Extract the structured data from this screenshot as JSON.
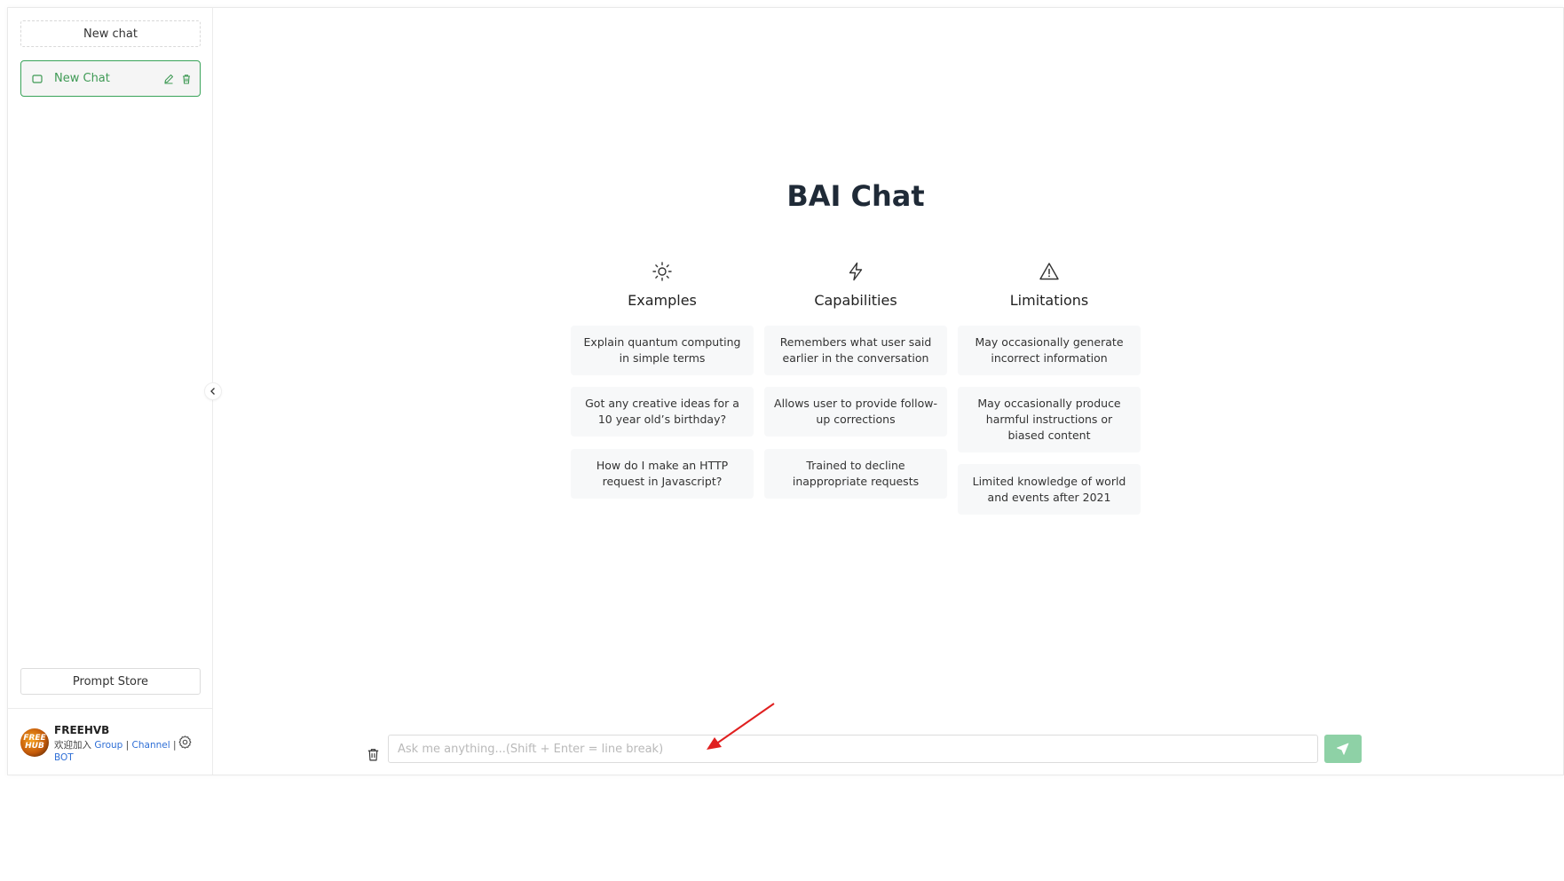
{
  "sidebar": {
    "new_chat_button": "New chat",
    "chat_items": [
      {
        "label": "New Chat"
      }
    ],
    "prompt_store_button": "Prompt Store",
    "user": {
      "name": "FREEHVB",
      "avatar_text": "FREE HUB",
      "welcome": "欢迎加入",
      "links": [
        "Group",
        "Channel",
        "BOT"
      ],
      "separator": "|"
    }
  },
  "main": {
    "title": "BAI Chat",
    "columns": [
      {
        "icon": "sun-icon",
        "title": "Examples",
        "cards": [
          "Explain quantum computing in simple terms",
          "Got any creative ideas for a 10 year old’s birthday?",
          "How do I make an HTTP request in Javascript?"
        ]
      },
      {
        "icon": "lightning-icon",
        "title": "Capabilities",
        "cards": [
          "Remembers what user said earlier in the conversation",
          "Allows user to provide follow-up corrections",
          "Trained to decline inappropriate requests"
        ]
      },
      {
        "icon": "warning-icon",
        "title": "Limitations",
        "cards": [
          "May occasionally generate incorrect information",
          "May occasionally produce harmful instructions or biased content",
          "Limited knowledge of world and events after 2021"
        ]
      }
    ]
  },
  "input": {
    "placeholder": "Ask me anything...(Shift + Enter = line break)",
    "value": ""
  },
  "colors": {
    "accent": "#3aa35a",
    "send_button": "#8ed1a6",
    "card_bg": "#f7f8f9",
    "link": "#2f6fd6",
    "annotation_arrow": "#e02020"
  }
}
